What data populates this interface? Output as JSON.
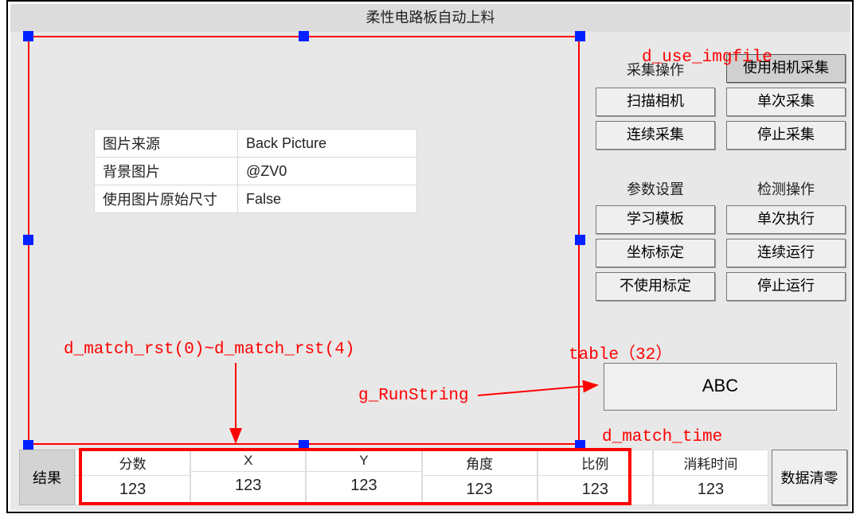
{
  "title": "柔性电路板自动上料",
  "properties": [
    {
      "key": "图片来源",
      "value": "Back Picture"
    },
    {
      "key": "背景图片",
      "value": "@ZV0"
    },
    {
      "key": "使用图片原始尺寸",
      "value": "False"
    }
  ],
  "capture": {
    "section_label": "采集操作",
    "use_camera": "使用相机采集",
    "scan_camera": "扫描相机",
    "single_capture": "单次采集",
    "continuous_capture": "连续采集",
    "stop_capture": "停止采集"
  },
  "params": {
    "section_label": "参数设置",
    "learn_template": "学习模板",
    "coord_calib": "坐标标定",
    "no_calib": "不使用标定"
  },
  "detect": {
    "section_label": "检测操作",
    "single_run": "单次执行",
    "continuous_run": "连续运行",
    "stop_run": "停止运行"
  },
  "abc_text": "ABC",
  "annotations": {
    "d_use_imgfile": "d_use_imgfile",
    "d_match_rst": "d_match_rst(0)~d_match_rst(4)",
    "g_RunString": "g_RunString",
    "table32": "table（32）",
    "d_match_time": "d_match_time"
  },
  "results": {
    "label": "结果",
    "columns": [
      "分数",
      "X",
      "Y",
      "角度",
      "比例",
      "消耗时间"
    ],
    "values": [
      "123",
      "123",
      "123",
      "123",
      "123",
      "123"
    ],
    "clear": "数据清零"
  }
}
